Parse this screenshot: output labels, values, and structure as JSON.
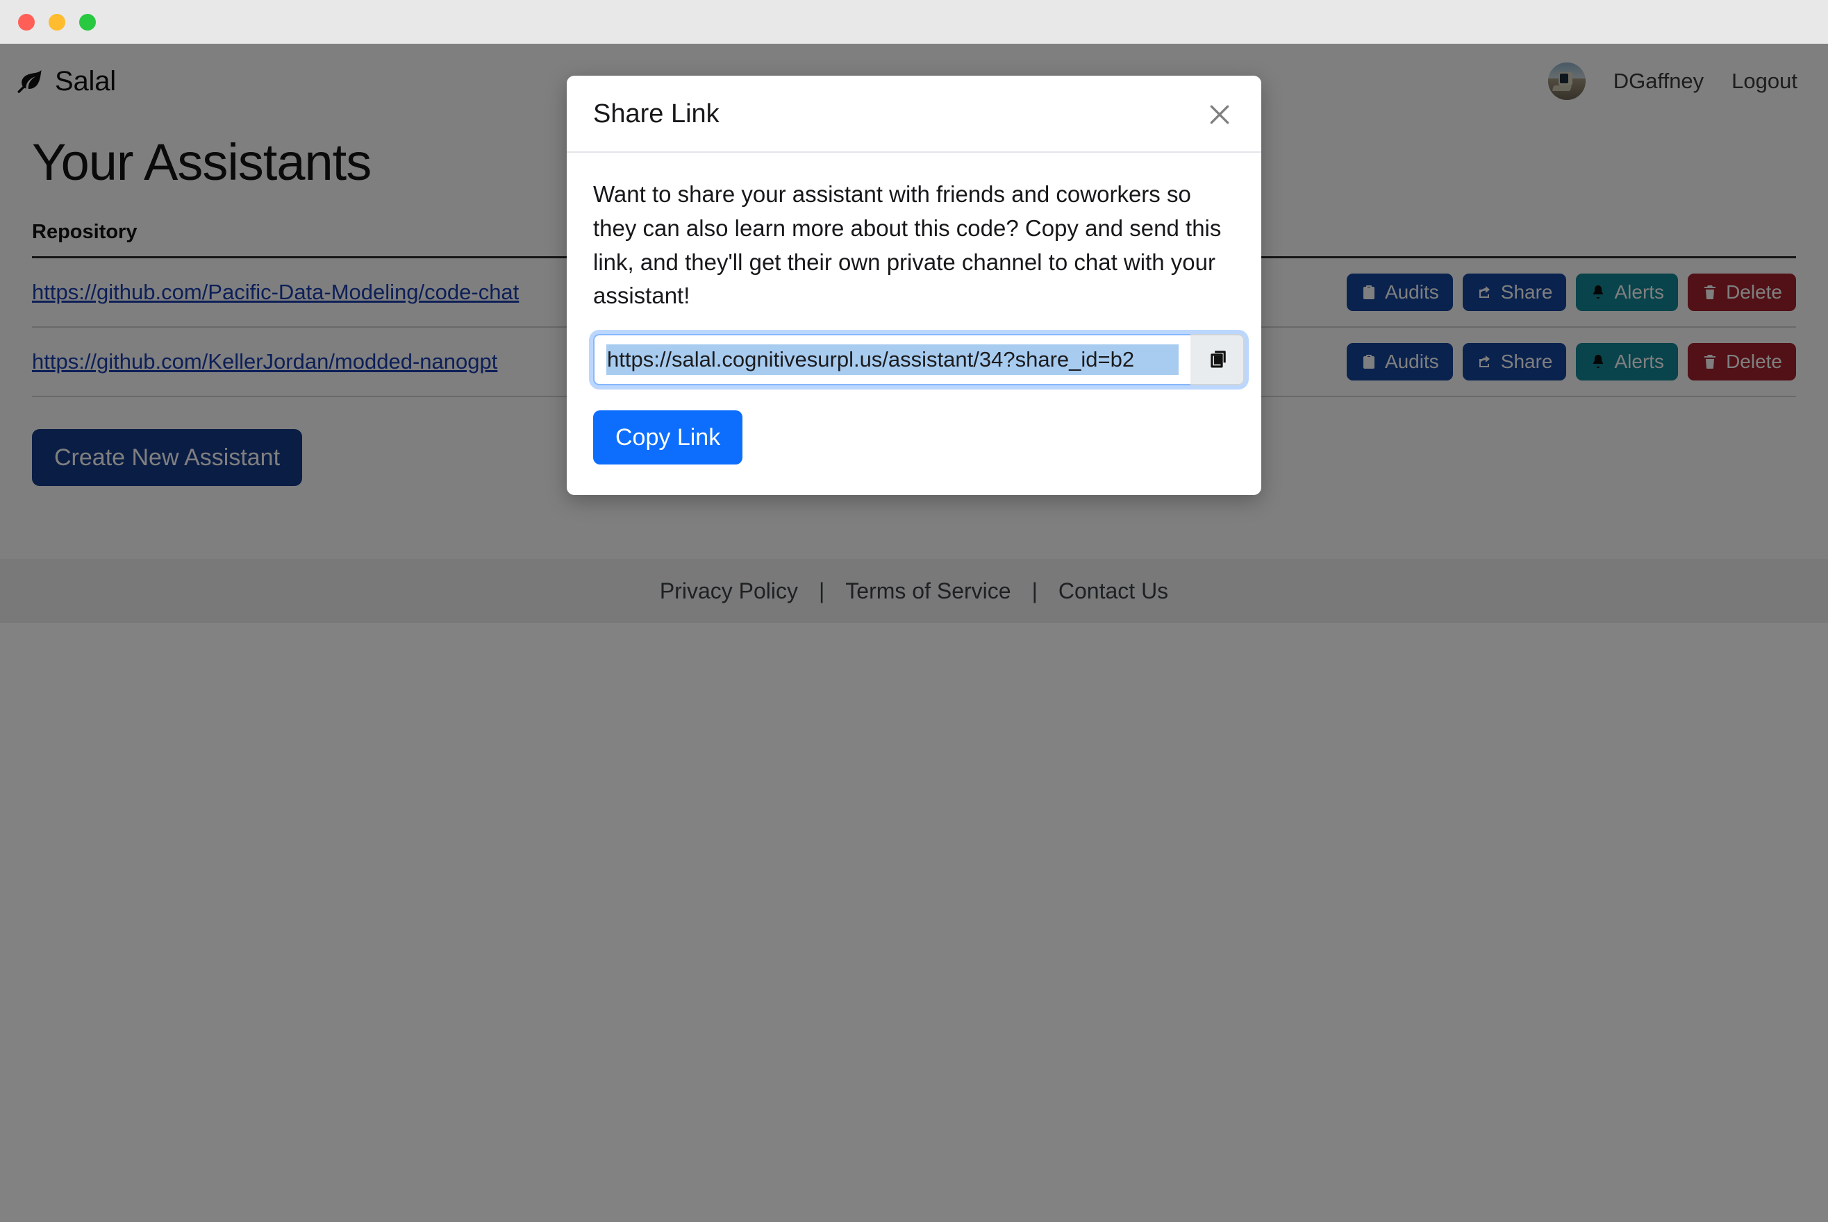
{
  "window": {
    "traffic_lights": [
      {
        "name": "close",
        "color": "#ff5f57"
      },
      {
        "name": "minimize",
        "color": "#febc2e"
      },
      {
        "name": "maximize",
        "color": "#28c840"
      }
    ]
  },
  "header": {
    "brand_name": "Salal",
    "logo_icon": "leaf-icon",
    "avatar_icon": "user-avatar",
    "username": "DGaffney",
    "logout_label": "Logout"
  },
  "main": {
    "page_title": "Your Assistants",
    "table": {
      "columns": [
        "Repository"
      ],
      "rows": [
        {
          "repository": "https://github.com/Pacific-Data-Modeling/code-chat",
          "actions": [
            {
              "label": "Audits",
              "icon": "clipboard-icon",
              "color": "#14449c",
              "style": "btn-audits"
            },
            {
              "label": "Share",
              "icon": "share-icon",
              "color": "#14449c",
              "style": "btn-share"
            },
            {
              "label": "Alerts",
              "icon": "bell-icon",
              "color": "#128796",
              "style": "btn-alerts"
            },
            {
              "label": "Delete",
              "icon": "trash-icon",
              "color": "#a3222c",
              "style": "btn-delete"
            }
          ]
        },
        {
          "repository": "https://github.com/KellerJordan/modded-nanogpt",
          "actions": [
            {
              "label": "Audits",
              "icon": "clipboard-icon",
              "color": "#14449c",
              "style": "btn-audits"
            },
            {
              "label": "Share",
              "icon": "share-icon",
              "color": "#14449c",
              "style": "btn-share"
            },
            {
              "label": "Alerts",
              "icon": "bell-icon",
              "color": "#128796",
              "style": "btn-alerts"
            },
            {
              "label": "Delete",
              "icon": "trash-icon",
              "color": "#a3222c",
              "style": "btn-delete"
            }
          ]
        }
      ]
    },
    "create_assistant_label": "Create New Assistant"
  },
  "footer": {
    "links": [
      "Privacy Policy",
      "Terms of Service",
      "Contact Us"
    ],
    "separator": "|"
  },
  "modal": {
    "title": "Share Link",
    "close_icon": "close-icon",
    "description": "Want to share your assistant with friends and coworkers so they can also learn more about this code? Copy and send this link, and they'll get their own private channel to chat with your assistant!",
    "share_link_value": "https://salal.cognitivesurpl.us/assistant/34?share_id=b2",
    "share_link_placeholder": "Share link",
    "copy_icon": "copy-icon",
    "copy_button_label": "Copy Link",
    "accent_color": "#0d6efd"
  }
}
